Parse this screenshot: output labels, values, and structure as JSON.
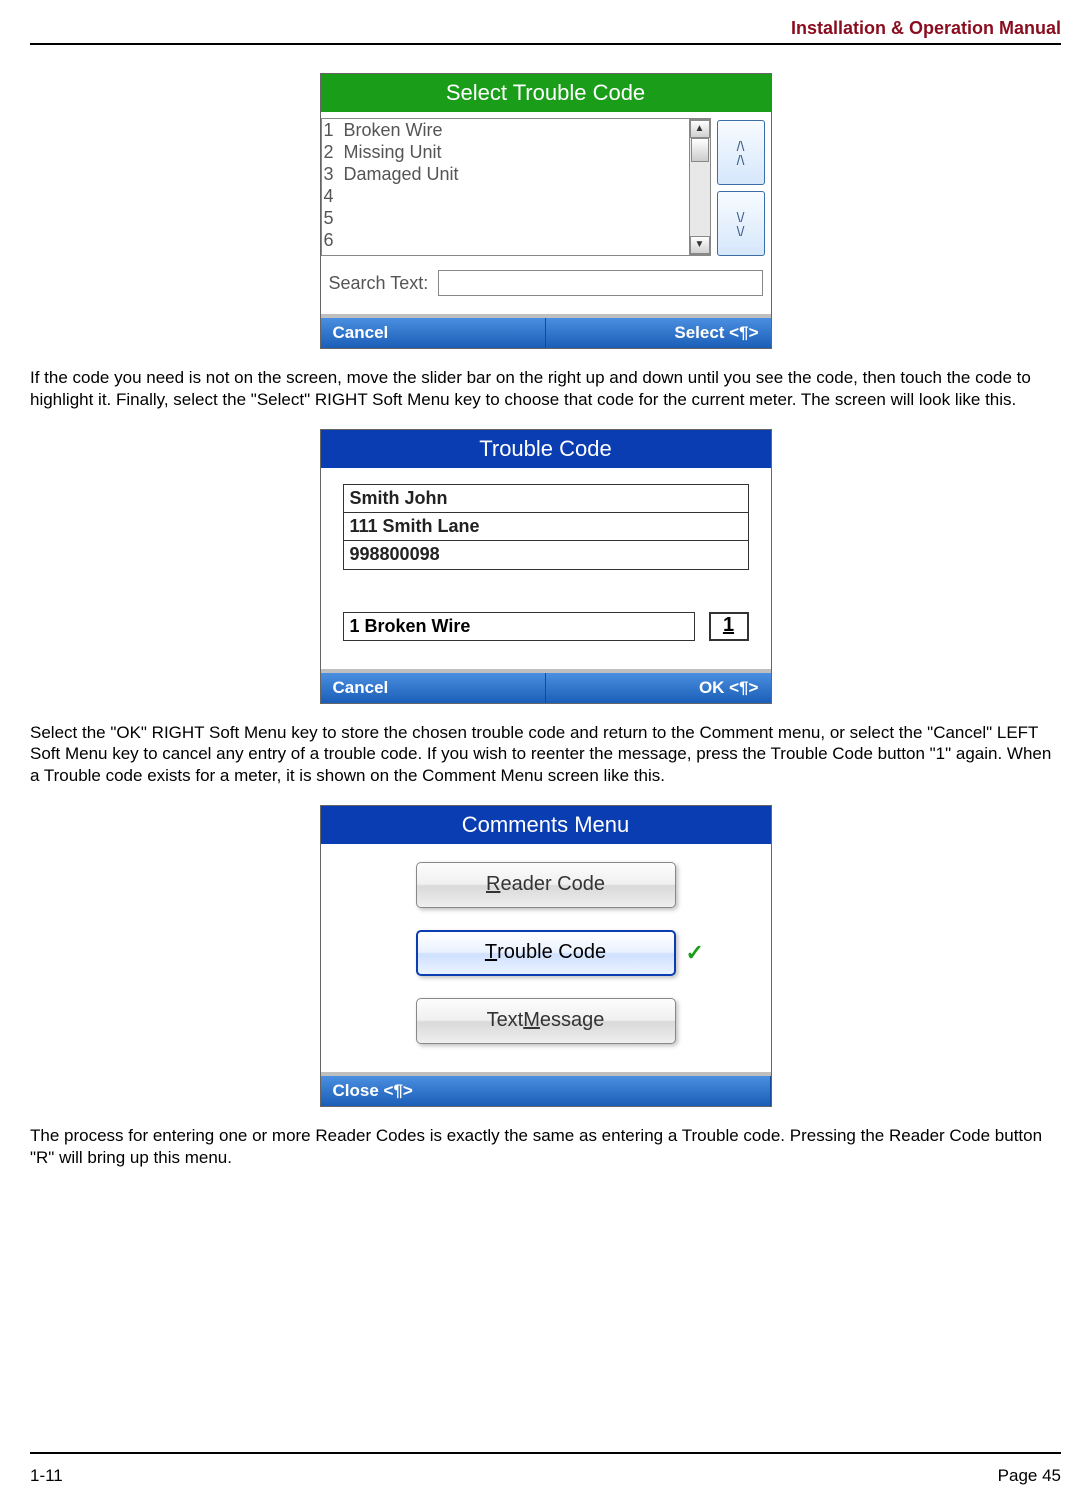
{
  "header": {
    "title": "Installation & Operation Manual"
  },
  "footer": {
    "left": "1-11",
    "right": "Page 45"
  },
  "para1": "If the code you need is not on the screen, move the slider bar on the right up and down until you see the code, then touch the code to highlight it.  Finally, select the \"Select\" RIGHT Soft Menu key to choose that code for the current meter.  The screen will look like this.",
  "para2": "Select the \"OK\" RIGHT Soft Menu key to store the chosen trouble code and return to the Comment menu, or select the \"Cancel\" LEFT Soft Menu key to cancel any entry of a trouble code.  If you wish to reenter the message, press the Trouble Code button \"1\" again.  When a Trouble code exists for a meter, it is shown on the Comment Menu screen like this.",
  "para3": "The process for entering one or more Reader Codes is exactly the same as entering a Trouble code.  Pressing the Reader Code button \"R\" will bring up this menu.",
  "screen1": {
    "title": "Select Trouble Code",
    "items": [
      {
        "n": "1",
        "t": "Broken Wire"
      },
      {
        "n": "2",
        "t": "Missing Unit"
      },
      {
        "n": "3",
        "t": "Damaged Unit"
      },
      {
        "n": "4",
        "t": ""
      },
      {
        "n": "5",
        "t": ""
      },
      {
        "n": "6",
        "t": ""
      }
    ],
    "search_label": "Search Text:",
    "search_value": "",
    "left": "Cancel",
    "right": "Select <¶>"
  },
  "screen2": {
    "title": "Trouble Code",
    "name": "Smith John",
    "addr": "111 Smith Lane",
    "acct": "998800098",
    "code_text": "1  Broken Wire",
    "code_num": "1",
    "left": "Cancel",
    "right": "OK <¶>"
  },
  "screen3": {
    "title": "Comments Menu",
    "btn_reader_pre": "",
    "btn_reader_u": "R",
    "btn_reader_post": "eader Code",
    "btn_trouble_pre": "",
    "btn_trouble_u": "T",
    "btn_trouble_post": "rouble Code",
    "btn_text_pre": "Text ",
    "btn_text_u": "M",
    "btn_text_post": "essage",
    "check": "✓",
    "left": "Close <¶>"
  }
}
